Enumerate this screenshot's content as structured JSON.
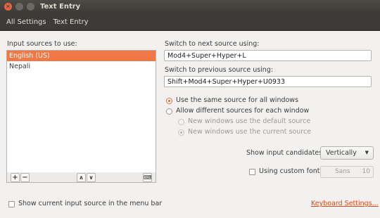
{
  "window": {
    "title": "Text Entry",
    "breadcrumbs": [
      "All Settings",
      "Text Entry"
    ]
  },
  "sources": {
    "label": "Input sources to use:",
    "items": [
      {
        "label": "English (US)",
        "selected": true
      },
      {
        "label": "Nepali",
        "selected": false
      }
    ]
  },
  "shortcuts": {
    "next_label": "Switch to next source using:",
    "next_value": "Mod4+Super+Hyper+L",
    "prev_label": "Switch to previous source using:",
    "prev_value": "Shift+Mod4+Super+Hyper+U0933"
  },
  "options": {
    "same_source": "Use the same source for all windows",
    "different_sources": "Allow different sources for each window",
    "new_default": "New windows use the default source",
    "new_current": "New windows use the current source"
  },
  "candidates": {
    "label": "Show input candidates:",
    "value": "Vertically"
  },
  "custom_font": {
    "label": "Using custom font:",
    "font_name": "Sans",
    "font_size": "10"
  },
  "footer": {
    "menu_bar_check": "Show current input source in the menu bar",
    "keyboard_settings_link": "Keyboard Settings..."
  },
  "colors": {
    "accent": "#f07746",
    "link": "#dd4814",
    "titlebar": "#3c3b37"
  }
}
